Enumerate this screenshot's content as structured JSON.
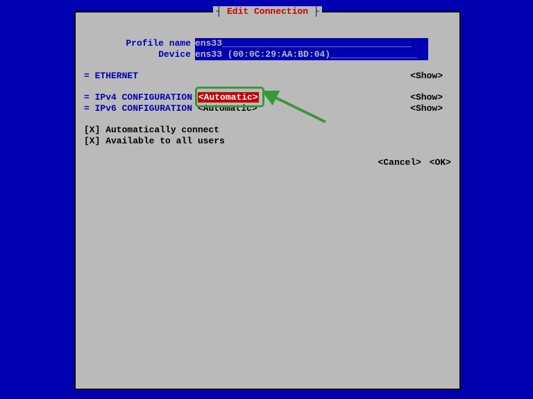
{
  "title": "Edit Connection",
  "fields": {
    "profile_label": "Profile name",
    "profile_value": "ens33",
    "device_label": "Device",
    "device_value": "ens33 (00:0C:29:AA:BD:04)"
  },
  "sections": {
    "ethernet_label": "= ETHERNET",
    "ipv4_label": "= IPv4 CONFIGURATION",
    "ipv4_mode": "<Automatic>",
    "ipv6_label": "= IPv6 CONFIGURATION",
    "ipv6_mode": "<Automatic>",
    "show_btn": "<Show>"
  },
  "checks": {
    "auto": "[X] Automatically connect",
    "avail": "[X] Available to all users"
  },
  "buttons": {
    "cancel": "<Cancel>",
    "ok": "<OK>"
  }
}
